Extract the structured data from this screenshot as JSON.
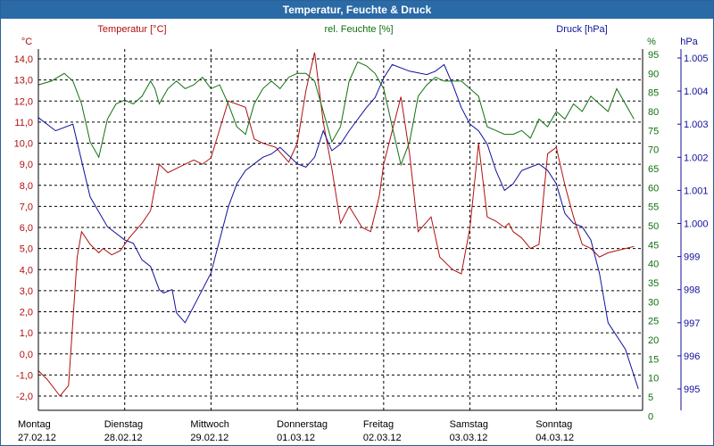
{
  "window": {
    "title": "Temperatur, Feuchte & Druck"
  },
  "colors": {
    "temperature": "#b01010",
    "humidity": "#107010",
    "pressure": "#10109a",
    "titlebar": "#2a6aa6",
    "grid": "#000000"
  },
  "chart_data": {
    "type": "line",
    "title": "Temperatur, Feuchte & Druck",
    "grid": true,
    "axes": {
      "temperature": {
        "unit": "°C",
        "label": "Temperatur [°C]",
        "ylim": [
          -2.0,
          14.0
        ],
        "ticks": [
          "14,0",
          "13,0",
          "12,0",
          "11,0",
          "10,0",
          "9,0",
          "8,0",
          "7,0",
          "6,0",
          "5,0",
          "4,0",
          "3,0",
          "2,0",
          "1,0",
          "0,0",
          "-1,0",
          "-2,0"
        ]
      },
      "humidity": {
        "unit": "%",
        "label": "rel. Feuchte [%]",
        "ylim": [
          5,
          95
        ],
        "ticks": [
          "95",
          "90",
          "85",
          "80",
          "75",
          "70",
          "65",
          "60",
          "55",
          "50",
          "45",
          "40",
          "35",
          "30",
          "25",
          "20",
          "15",
          "10",
          "5",
          "0"
        ]
      },
      "pressure": {
        "unit": "hPa",
        "label": "Druck [hPa]",
        "ylim": [
          995,
          1005
        ],
        "ticks": [
          "1.005",
          "1.004",
          "1.003",
          "1.002",
          "1.001",
          "1.000",
          "999",
          "998",
          "997",
          "996",
          "995"
        ]
      }
    },
    "x_labels": [
      {
        "day": "Montag",
        "date": "27.02.12"
      },
      {
        "day": "Dienstag",
        "date": "28.02.12"
      },
      {
        "day": "Mittwoch",
        "date": "29.02.12"
      },
      {
        "day": "Donnerstag",
        "date": "01.03.12"
      },
      {
        "day": "Freitag",
        "date": "02.03.12"
      },
      {
        "day": "Samstag",
        "date": "03.03.12"
      },
      {
        "day": "Sonntag",
        "date": "04.03.12"
      }
    ],
    "x_range_days": [
      0,
      7
    ],
    "series": [
      {
        "name": "Temperatur [°C]",
        "axis": "temperature",
        "x": [
          0,
          0.1,
          0.25,
          0.35,
          0.45,
          0.5,
          0.6,
          0.7,
          0.75,
          0.85,
          0.95,
          1.05,
          1.2,
          1.3,
          1.4,
          1.5,
          1.6,
          1.7,
          1.8,
          1.9,
          2.0,
          2.2,
          2.4,
          2.5,
          2.6,
          2.75,
          2.9,
          3.0,
          3.1,
          3.2,
          3.3,
          3.4,
          3.5,
          3.6,
          3.75,
          3.85,
          3.95,
          4.0,
          4.2,
          4.3,
          4.4,
          4.55,
          4.65,
          4.8,
          4.9,
          5.0,
          5.1,
          5.2,
          5.3,
          5.4,
          5.45,
          5.5,
          5.6,
          5.7,
          5.8,
          5.9,
          6.0,
          6.1,
          6.2,
          6.3,
          6.4,
          6.5,
          6.6,
          6.8,
          6.9
        ],
        "y": [
          -0.8,
          -1.2,
          -2.0,
          -1.5,
          4.6,
          5.8,
          5.2,
          4.8,
          5.0,
          4.7,
          4.9,
          5.5,
          6.2,
          6.8,
          9.0,
          8.6,
          8.8,
          9.0,
          9.2,
          9.0,
          9.3,
          12.0,
          11.7,
          10.2,
          10.0,
          9.8,
          9.1,
          10.0,
          12.5,
          14.3,
          11.0,
          8.8,
          6.2,
          7.0,
          6.0,
          5.8,
          7.5,
          9.0,
          12.2,
          9.5,
          5.8,
          6.5,
          4.6,
          4.0,
          3.8,
          6.0,
          10.0,
          6.5,
          6.3,
          6.0,
          6.2,
          5.8,
          5.5,
          5.0,
          5.2,
          9.5,
          9.8,
          8.0,
          6.5,
          5.2,
          5.0,
          4.6,
          4.8,
          5.0,
          5.1
        ]
      },
      {
        "name": "rel. Feuchte [%]",
        "axis": "humidity",
        "x": [
          0,
          0.15,
          0.3,
          0.4,
          0.5,
          0.6,
          0.7,
          0.8,
          0.9,
          1.0,
          1.1,
          1.2,
          1.3,
          1.35,
          1.4,
          1.5,
          1.6,
          1.7,
          1.8,
          1.9,
          2.0,
          2.1,
          2.2,
          2.3,
          2.4,
          2.5,
          2.6,
          2.7,
          2.8,
          2.9,
          3.0,
          3.1,
          3.2,
          3.3,
          3.4,
          3.5,
          3.6,
          3.7,
          3.8,
          3.9,
          4.0,
          4.1,
          4.2,
          4.3,
          4.4,
          4.5,
          4.6,
          4.7,
          4.8,
          4.9,
          5.0,
          5.1,
          5.2,
          5.3,
          5.4,
          5.5,
          5.6,
          5.7,
          5.8,
          5.9,
          6.0,
          6.1,
          6.2,
          6.3,
          6.4,
          6.5,
          6.6,
          6.7,
          6.8,
          6.9
        ],
        "y": [
          87,
          88,
          90,
          88,
          82,
          72,
          68,
          78,
          82,
          83,
          82,
          84,
          88,
          86,
          82,
          86,
          88,
          86,
          87,
          89,
          86,
          87,
          82,
          76,
          74,
          82,
          86,
          88,
          86,
          89,
          90,
          90,
          88,
          80,
          72,
          76,
          88,
          93,
          92,
          90,
          86,
          76,
          66,
          72,
          84,
          87,
          89,
          88,
          88,
          88,
          86,
          84,
          76,
          75,
          74,
          74,
          75,
          73,
          78,
          76,
          80,
          78,
          82,
          80,
          84,
          82,
          80,
          86,
          82,
          78
        ]
      },
      {
        "name": "Druck [hPa]",
        "axis": "pressure",
        "x": [
          0,
          0.2,
          0.4,
          0.6,
          0.8,
          1.0,
          1.1,
          1.2,
          1.3,
          1.4,
          1.45,
          1.55,
          1.6,
          1.7,
          1.8,
          2.0,
          2.1,
          2.2,
          2.3,
          2.4,
          2.5,
          2.6,
          2.7,
          2.8,
          3.0,
          3.1,
          3.2,
          3.3,
          3.4,
          3.5,
          3.6,
          3.8,
          3.9,
          4.0,
          4.1,
          4.3,
          4.5,
          4.6,
          4.7,
          4.8,
          4.9,
          5.0,
          5.1,
          5.2,
          5.3,
          5.4,
          5.5,
          5.6,
          5.7,
          5.8,
          5.9,
          6.0,
          6.1,
          6.2,
          6.3,
          6.4,
          6.5,
          6.6,
          6.8,
          6.95
        ],
        "y": [
          1003.2,
          1002.8,
          1003.0,
          1000.8,
          999.9,
          999.5,
          999.4,
          998.9,
          998.7,
          998.0,
          997.9,
          998.0,
          997.3,
          997.0,
          997.5,
          998.5,
          999.5,
          1000.5,
          1001.2,
          1001.6,
          1001.8,
          1002.0,
          1002.1,
          1002.3,
          1001.8,
          1001.7,
          1002.0,
          1002.8,
          1002.2,
          1002.4,
          1002.8,
          1003.5,
          1003.8,
          1004.4,
          1004.8,
          1004.6,
          1004.5,
          1004.6,
          1004.8,
          1004.2,
          1003.5,
          1003.0,
          1002.8,
          1002.4,
          1001.6,
          1001.0,
          1001.2,
          1001.6,
          1001.7,
          1001.8,
          1001.6,
          1001.2,
          1000.3,
          1000.0,
          999.9,
          999.5,
          998.5,
          997.0,
          996.2,
          995.0
        ]
      }
    ]
  }
}
